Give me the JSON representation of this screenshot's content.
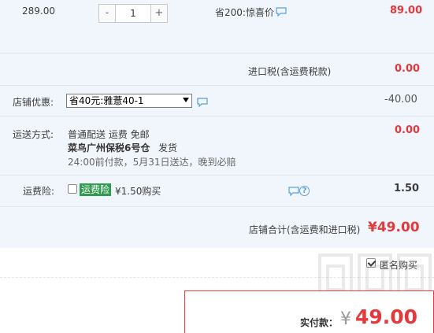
{
  "item": {
    "price": "289.00",
    "qty_minus": "-",
    "qty_value": "1",
    "qty_plus": "+",
    "saving_note": "省200:惊喜价",
    "amount": "89.00"
  },
  "import_tax": {
    "label": "进口税(含运费税款)",
    "amount": "0.00"
  },
  "shop_discount": {
    "label": "店铺优惠:",
    "selected": "省40元:雅薏40-1",
    "amount": "-40.00"
  },
  "shipping": {
    "label": "运送方式:",
    "method": "普通配送 运费 免邮",
    "warehouse": "菜鸟广州保税6号仓",
    "ship_text": "发货",
    "promise": "24:00前付款，5月31日送达，晚到必赔",
    "amount": "0.00"
  },
  "insurance": {
    "label": "运费险:",
    "badge": "运费险",
    "price_text": "¥1.50购买",
    "amount": "1.50",
    "help_glyph": "?"
  },
  "shop_total": {
    "label": "店铺合计(含运费和进口税)",
    "amount": "¥49.00"
  },
  "anonymous": {
    "label": "匿名购买",
    "checked": true
  },
  "payment": {
    "label": "实付款：",
    "currency": "¥",
    "amount": "49.00"
  },
  "colors": {
    "accent_red": "#e4393c",
    "panel_bg": "#f1f6fc",
    "badge_green": "#2e9b4e"
  }
}
